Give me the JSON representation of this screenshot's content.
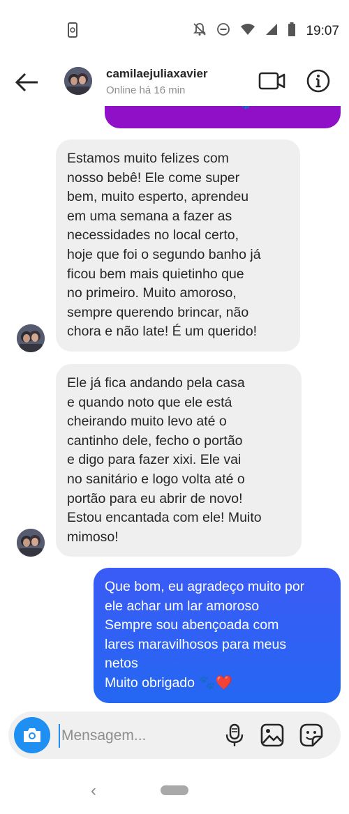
{
  "status_bar": {
    "time": "19:07",
    "icons": [
      "screenshot-icon",
      "mute-icon",
      "dnd-icon",
      "wifi-icon",
      "signal-icon",
      "battery-icon"
    ]
  },
  "header": {
    "username": "camilaejuliaxavier",
    "status": "Online há 16 min",
    "icons": [
      "back-arrow-icon",
      "video-call-icon",
      "info-icon"
    ]
  },
  "messages": [
    {
      "direction": "incoming",
      "text": "Estamos muito felizes com\nnosso bebê! Ele come super\nbem, muito esperto, aprendeu\nem uma semana a fazer as\nnecessidades no local certo,\nhoje que foi o segundo banho já\nficou bem mais quietinho que\nno primeiro. Muito amoroso,\nsempre querendo brincar, não\nchora e não late! É um querido!"
    },
    {
      "direction": "incoming",
      "text": "Ele já fica andando pela casa\ne quando noto que ele está\ncheirando muito levo até o\ncantinho dele, fecho o portão\ne digo para fazer xixi. Ele vai\nno sanitário e logo volta até o\nportão para eu abrir de novo!\nEstou encantada com ele! Muito\nmimoso!"
    },
    {
      "direction": "outgoing",
      "text": "Que bom, eu agradeço muito por\nele achar um lar amoroso\nSempre sou abençoada com\nlares maravilhosos para meus\nnetos\nMuito obrigado 🐾❤️"
    }
  ],
  "composer": {
    "placeholder": "Mensagem...",
    "icons": [
      "camera-icon",
      "microphone-icon",
      "gallery-icon",
      "sticker-icon"
    ]
  },
  "colors": {
    "outgoing_bubble": "#2f62f4",
    "incoming_bubble": "#efefef",
    "previous_bubble": "#9010c8",
    "camera_button": "#1f8ff2"
  }
}
